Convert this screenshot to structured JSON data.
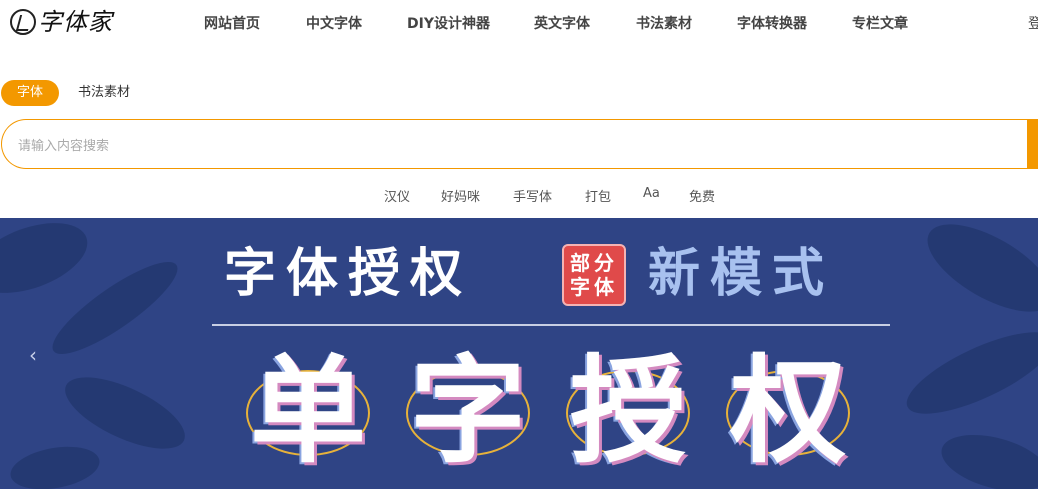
{
  "header": {
    "logo_text": "字体家",
    "nav": [
      {
        "label": "网站首页",
        "name": "nav-home"
      },
      {
        "label": "中文字体",
        "name": "nav-chinese-fonts"
      },
      {
        "label": "DIY设计神器",
        "name": "nav-diy-design"
      },
      {
        "label": "英文字体",
        "name": "nav-english-fonts"
      },
      {
        "label": "书法素材",
        "name": "nav-calligraphy"
      },
      {
        "label": "字体转换器",
        "name": "nav-font-converter"
      },
      {
        "label": "专栏文章",
        "name": "nav-articles"
      }
    ],
    "login_partial": "登"
  },
  "search": {
    "tabs": [
      {
        "label": "字体",
        "active": true
      },
      {
        "label": "书法素材",
        "active": false
      }
    ],
    "placeholder": "请输入内容搜索",
    "hot_words": [
      "汉仪",
      "好妈咪",
      "手写体",
      "打包",
      "Aa",
      "免费"
    ]
  },
  "banner": {
    "title_left": "字体授权",
    "seal_line1": "部分",
    "seal_line2": "字体",
    "title_right": "新模式",
    "big_chars": [
      "单",
      "字",
      "授",
      "权"
    ],
    "prev_icon": "‹"
  },
  "colors": {
    "accent": "#f39800",
    "banner_bg": "#2f4485",
    "seal_red": "#e04a4a",
    "ring_gold": "#e7b23a"
  }
}
